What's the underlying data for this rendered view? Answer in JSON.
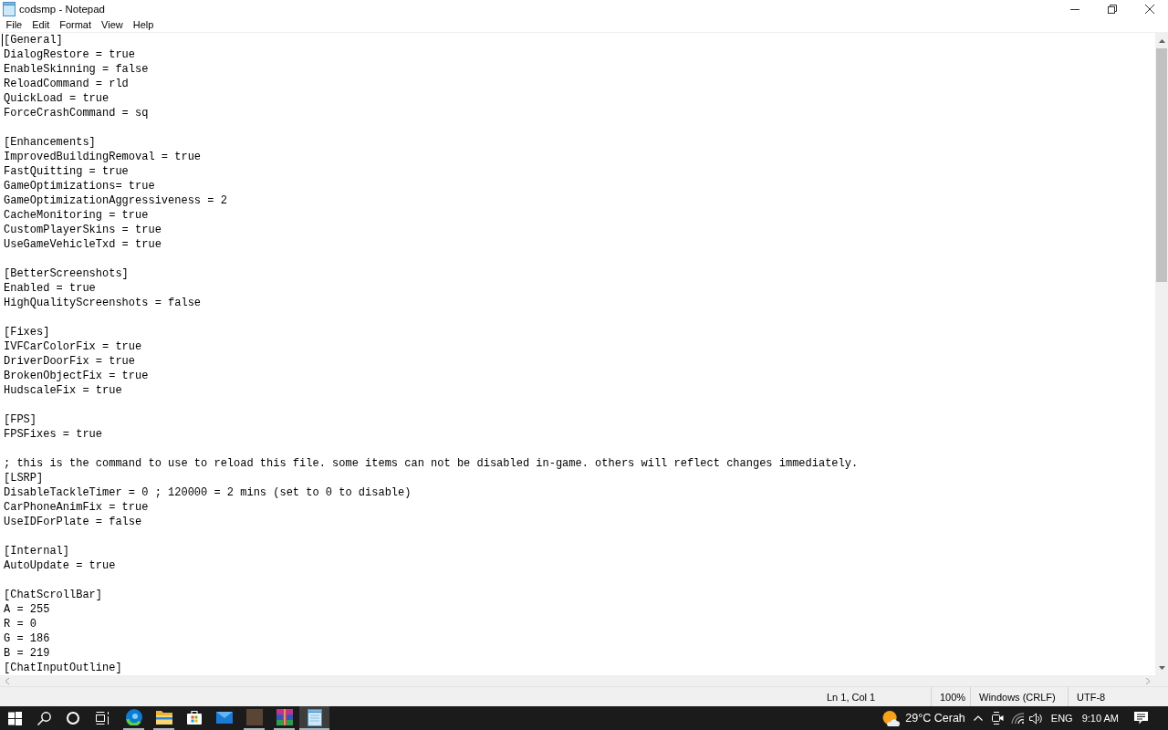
{
  "window": {
    "title": "codsmp - Notepad"
  },
  "menu": [
    "File",
    "Edit",
    "Format",
    "View",
    "Help"
  ],
  "editor": {
    "blocks": [
      [
        "[General]",
        "DialogRestore = true",
        "EnableSkinning = false",
        "ReloadCommand = rld",
        "QuickLoad = true",
        "ForceCrashCommand = sq"
      ],
      [
        "[Enhancements]",
        "ImprovedBuildingRemoval = true",
        "FastQuitting = true",
        "GameOptimizations= true",
        "GameOptimizationAggressiveness = 2",
        "CacheMonitoring = true",
        "CustomPlayerSkins = true",
        "UseGameVehicleTxd = true"
      ],
      [
        "[BetterScreenshots]",
        "Enabled = true",
        "HighQualityScreenshots = false"
      ],
      [
        "[Fixes]",
        "IVFCarColorFix = true",
        "DriverDoorFix = true",
        "BrokenObjectFix = true",
        "HudscaleFix = true"
      ],
      [
        "[FPS]",
        "FPSFixes = true"
      ],
      [
        "; this is the command to use to reload this file. some items can not be disabled in-game. others will reflect changes immediately.",
        "[LSRP]",
        "DisableTackleTimer = 0 ; 120000 = 2 mins (set to 0 to disable)",
        "CarPhoneAnimFix = true",
        "UseIDForPlate = false"
      ],
      [
        "[Internal]",
        "AutoUpdate = true"
      ],
      [
        "[ChatScrollBar]",
        "A = 255",
        "R = 0",
        "G = 186",
        "B = 219",
        "[ChatInputOutline]"
      ]
    ]
  },
  "status_bar": [
    "Ln 1, Col 1",
    "100%",
    "Windows (CRLF)",
    "UTF-8"
  ],
  "taskbar": {
    "apps": [
      {
        "kind": "browser",
        "running": true,
        "selected": false
      },
      {
        "kind": "files",
        "running": true,
        "selected": false
      },
      {
        "kind": "store",
        "running": false,
        "selected": false
      },
      {
        "kind": "mail",
        "running": false,
        "selected": false
      },
      {
        "kind": "game",
        "running": true,
        "selected": false
      },
      {
        "kind": "archive",
        "running": true,
        "selected": false
      },
      {
        "kind": "notepad",
        "running": true,
        "selected": true
      }
    ],
    "tray": {
      "weather": "29°C Cerah",
      "language": "ENG",
      "time": "9:10 AM"
    }
  }
}
